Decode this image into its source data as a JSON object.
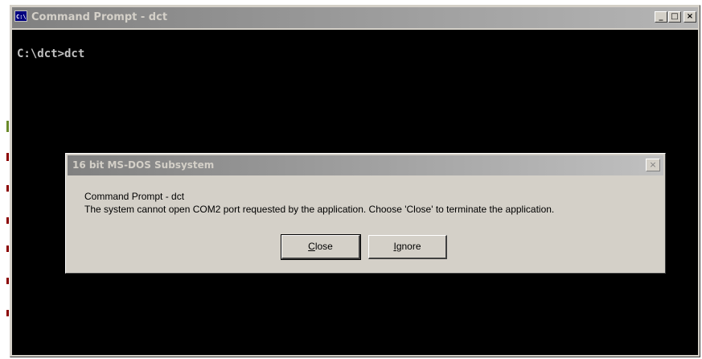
{
  "cmd_window": {
    "title": "Command Prompt - dct",
    "icon": "console-icon",
    "console_line": "C:\\dct>dct",
    "caption_buttons": {
      "minimize": "_",
      "maximize": "□",
      "close": "×"
    }
  },
  "dialog": {
    "title": "16 bit MS-DOS Subsystem",
    "close_glyph": "×",
    "line1": "Command Prompt - dct",
    "line2": "The system cannot open COM2 port requested by the application. Choose 'Close' to terminate the application.",
    "buttons": {
      "close": {
        "accel": "C",
        "rest": "lose"
      },
      "ignore": {
        "accel": "I",
        "rest": "gnore"
      }
    }
  },
  "colors": {
    "console_bg": "#000000",
    "console_text": "#c0c0c0",
    "inactive_title_start": "#808080",
    "inactive_title_end": "#c0c0c0",
    "window_face": "#d4d0c8"
  }
}
